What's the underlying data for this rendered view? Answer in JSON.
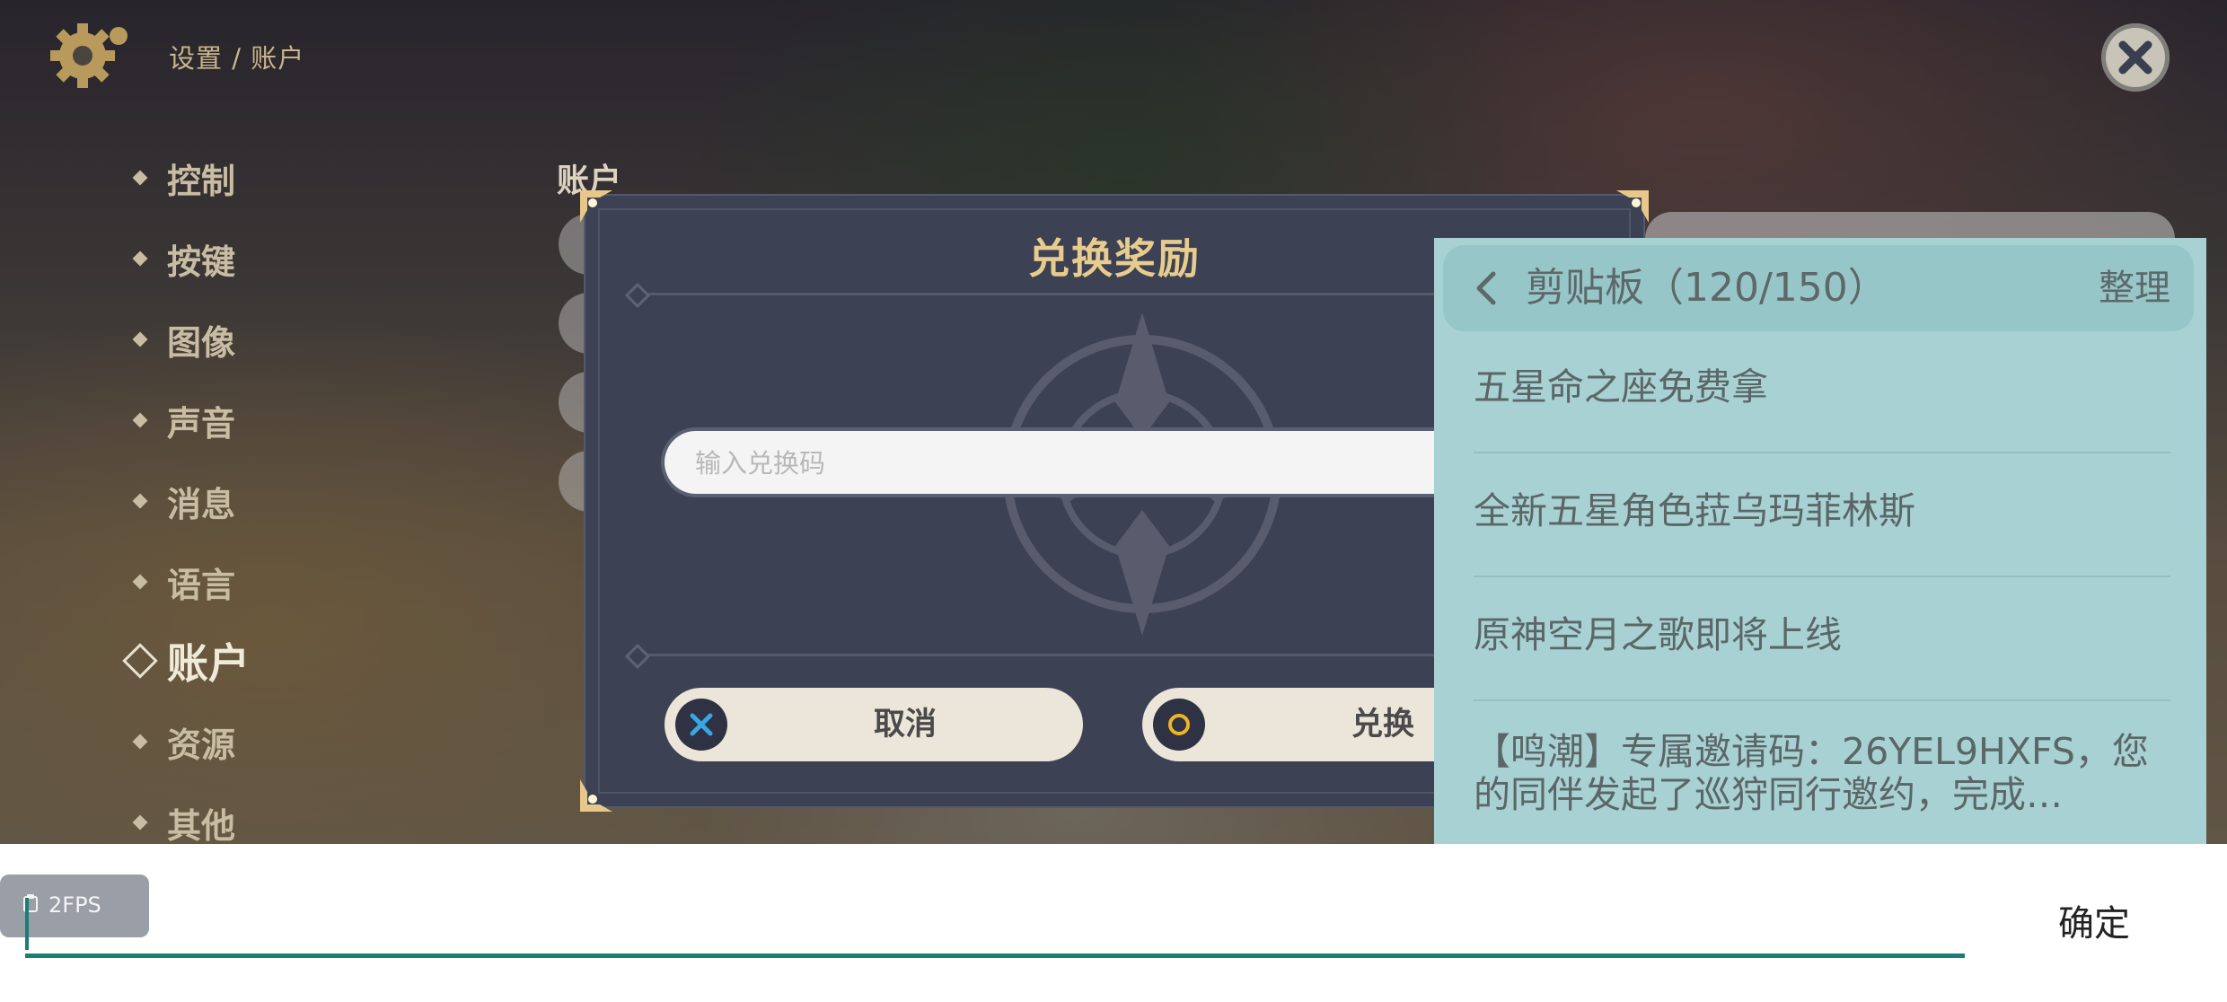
{
  "header": {
    "breadcrumb": "设置 / 账户",
    "settings_icon": "gear-icon",
    "close_icon": "close-icon"
  },
  "sidebar": {
    "items": [
      {
        "label": "控制"
      },
      {
        "label": "按键"
      },
      {
        "label": "图像"
      },
      {
        "label": "声音"
      },
      {
        "label": "消息"
      },
      {
        "label": "语言"
      },
      {
        "label": "账户",
        "active": true
      },
      {
        "label": "资源"
      },
      {
        "label": "其他"
      }
    ]
  },
  "main": {
    "section_title": "账户"
  },
  "dialog": {
    "title": "兑换奖励",
    "input_placeholder": "输入兑换码",
    "input_value": "",
    "cancel_label": "取消",
    "cancel_icon": "cross-icon",
    "redeem_label": "兑换",
    "redeem_icon": "circle-icon"
  },
  "clipboard": {
    "title": "剪贴板（120/150）",
    "manage_label": "整理",
    "items": [
      "五星命之座免费拿",
      "全新五星角色菈乌玛菲林斯",
      "原神空月之歌即将上线",
      "【鸣潮】专属邀请码：26YEL9HXFS，您的同伴发起了巡狩同行邀约，完成…"
    ]
  },
  "ime": {
    "fps_label": "2FPS",
    "input_value": "",
    "confirm_label": "确定"
  },
  "colors": {
    "accent_gold": "#e8cc8e",
    "dialog_bg": "#3d4154",
    "clipboard_bg": "#a8d1d4",
    "ime_accent": "#1a7e75"
  }
}
